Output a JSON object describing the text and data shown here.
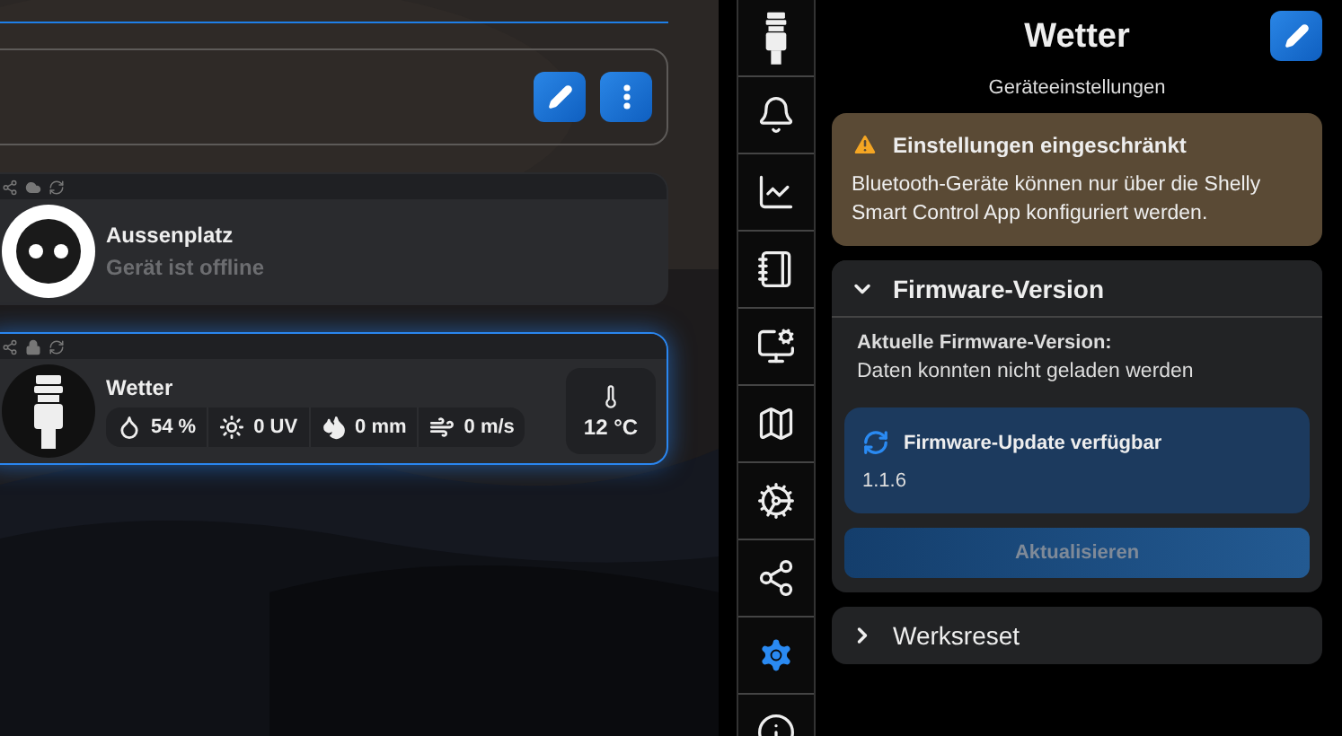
{
  "group_card": {
    "buttons": [
      {
        "kind": "edit"
      },
      {
        "kind": "more"
      }
    ]
  },
  "devices": [
    {
      "kind": "plug",
      "name": "Aussenplatz",
      "status": "Gerät ist offline",
      "selected": false,
      "header_icons": [
        {
          "kind": "share"
        },
        {
          "kind": "cloud"
        },
        {
          "kind": "sync"
        }
      ]
    },
    {
      "kind": "sensor",
      "name": "Wetter",
      "selected": true,
      "header_icons": [
        {
          "kind": "share"
        },
        {
          "kind": "lock"
        },
        {
          "kind": "sync"
        }
      ],
      "readings": [
        {
          "kind": "humidity",
          "value": "54 %"
        },
        {
          "kind": "uv",
          "value": "0 UV"
        },
        {
          "kind": "rain",
          "value": "0 mm"
        },
        {
          "kind": "wind",
          "value": "0 m/s"
        }
      ],
      "temperature": "12 °C"
    }
  ],
  "rail": [
    {
      "kind": "device",
      "selected": false
    },
    {
      "kind": "alerts",
      "selected": false
    },
    {
      "kind": "chart",
      "selected": false
    },
    {
      "kind": "log",
      "selected": false
    },
    {
      "kind": "device_settings",
      "selected": false
    },
    {
      "kind": "map",
      "selected": false
    },
    {
      "kind": "advanced",
      "selected": false
    },
    {
      "kind": "share",
      "selected": false
    },
    {
      "kind": "settings",
      "selected": true
    },
    {
      "kind": "info",
      "selected": false
    }
  ],
  "panel": {
    "title": "Wetter",
    "subtitle": "Geräteeinstellungen",
    "warning": {
      "title": "Einstellungen eingeschränkt",
      "text": "Bluetooth-Geräte können nur über die Shelly Smart Control App konfiguriert werden."
    },
    "sections": [
      {
        "title": "Firmware-Version",
        "expanded": true,
        "current_label": "Aktuelle Firmware-Version:",
        "current_value": "Daten konnten nicht geladen werden",
        "update_title": "Firmware-Update verfügbar",
        "update_version": "1.1.6",
        "button": {
          "label": "Aktualisieren",
          "disabled": true
        }
      },
      {
        "title": "Werksreset",
        "expanded": false
      }
    ]
  }
}
